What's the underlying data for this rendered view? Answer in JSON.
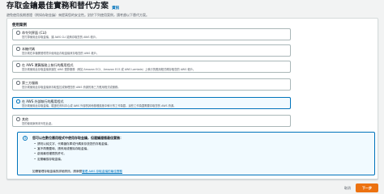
{
  "header": {
    "title": "存取金鑰最佳實務和替代方案",
    "info_link": "資訊",
    "subtitle": "避免使用長期憑證（例如存取金鑰）來提高您的安全性。對於下列使用案例，請考慮以下替代方案。"
  },
  "section": {
    "label": "使用案例"
  },
  "options": [
    {
      "title": "命令列界面 (CLI)",
      "description": "您打算使用此存取金鑰，讓 AWS CLI 能夠存取您的 AWS 帳戶。",
      "selected": false
    },
    {
      "title": "本機代碼",
      "description": "您計劃在本機開發環境中使用此存取金鑰來存取您的 AWS 帳戶。",
      "selected": false
    },
    {
      "title": "在 AWS 運算服務上執行的應用程式",
      "description": "您計劃使用此存取金鑰來讓在 AWS 運算服務（例如 Amazon EC2、Amazon ECS 或 AWS Lambda）上執行的應用程式碼存取您的 AWS 帳戶。",
      "selected": false
    },
    {
      "title": "第三方服務",
      "description": "您計劃使用此存取金鑰來存取監控或管理您的 AWS 資源的第三方應用程式或服務。",
      "selected": false
    },
    {
      "title": "在 AWS 外部執行的應用程式",
      "description": "您計劃使用此存取金鑰，驗證在資料中心或 AWS 外部的其他基礎設施中執行的工作負載，這些工作負載需要存取您的 AWS 資源。",
      "selected": true
    },
    {
      "title": "其他",
      "description": "您的使用案例未列在此處。",
      "selected": false
    }
  ],
  "infobox": {
    "icon": "info-icon",
    "heading": "您可以在數位應用程式中使用存取金鑰，但建議遵循最佳實務：",
    "bullets": [
      "請勿以純文字、代碼儲存庫或代碼來存放您的存取金鑰。",
      "當不再需要時，請停用或刪除存取金鑰。",
      "啟用最低權限的許可。",
      "定期輪換存取金鑰。"
    ],
    "footer_prefix": "如需管理存取金鑰的詳細資訊，請參閱",
    "footer_link": "管理 AWS 存取金鑰的最佳實務"
  },
  "footer": {
    "cancel_label": "取消",
    "next_label": "下一步"
  },
  "colors": {
    "accent": "#0073bb",
    "primary_button": "#ec7211",
    "background": "#f2f3f3"
  }
}
